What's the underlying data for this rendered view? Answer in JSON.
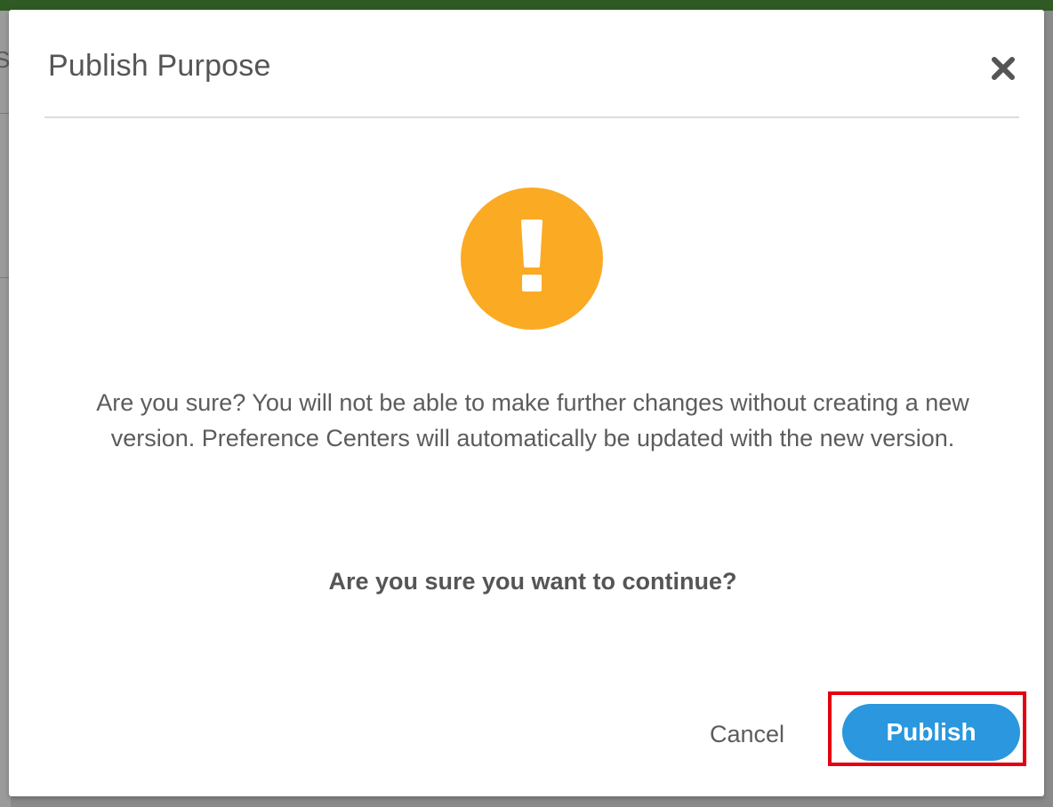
{
  "backdrop": {
    "peek_text": "S"
  },
  "modal": {
    "title": "Publish Purpose",
    "close_icon": "close-icon",
    "warning_icon": "exclamation-circle-icon",
    "message": "Are you sure? You will not be able to make further changes without creating a new version. Preference Centers will automatically be updated with the new version.",
    "question": "Are you sure you want to continue?",
    "cancel_label": "Cancel",
    "publish_label": "Publish"
  },
  "colors": {
    "warning": "#fbaa24",
    "primary_button": "#2a97de",
    "highlight_border": "#e3000f",
    "topbar": "#2f5a23"
  }
}
